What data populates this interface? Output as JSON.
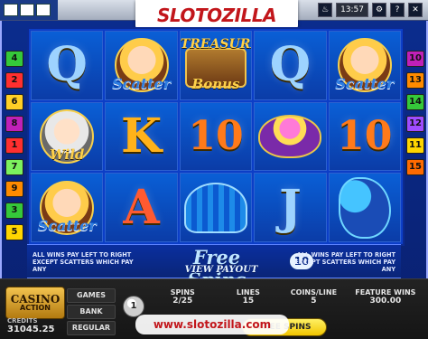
{
  "brand": {
    "logo_text": "SLOTOZILLA"
  },
  "top_bar": {
    "time": "13:57",
    "icons": [
      "fire-icon",
      "settings-icon",
      "help-icon",
      "close-icon"
    ]
  },
  "paylines": {
    "left": [
      {
        "label": "4",
        "color": "#35c83a"
      },
      {
        "label": "2",
        "color": "#ff2f2f"
      },
      {
        "label": "6",
        "color": "#ffcf26"
      },
      {
        "label": "8",
        "color": "#c020b8"
      },
      {
        "label": "1",
        "color": "#ff2f2f"
      },
      {
        "label": "7",
        "color": "#7cf15e"
      },
      {
        "label": "9",
        "color": "#ff8a00"
      },
      {
        "label": "3",
        "color": "#35c83a"
      },
      {
        "label": "5",
        "color": "#ffd500"
      }
    ],
    "right": [
      {
        "label": "10",
        "color": "#c020b8"
      },
      {
        "label": "13",
        "color": "#ff8a00"
      },
      {
        "label": "14",
        "color": "#35c83a"
      },
      {
        "label": "12",
        "color": "#a04cff"
      },
      {
        "label": "11",
        "color": "#ffd500"
      },
      {
        "label": "15",
        "color": "#ff6a00"
      }
    ]
  },
  "reels": [
    {
      "symbol": "Q",
      "kind": "letter",
      "color": "q"
    },
    {
      "symbol": "",
      "kind": "portrait",
      "caption": "Scatter"
    },
    {
      "symbol": "",
      "kind": "treasure",
      "caption_top": "TREASURE",
      "caption": "Bonus"
    },
    {
      "symbol": "Q",
      "kind": "letter",
      "color": "q"
    },
    {
      "symbol": "",
      "kind": "portrait",
      "caption": "Scatter"
    },
    {
      "symbol": "",
      "kind": "wild",
      "caption": "Wild"
    },
    {
      "symbol": "K",
      "kind": "letter",
      "color": "k"
    },
    {
      "symbol": "10",
      "kind": "letter",
      "color": "ten"
    },
    {
      "symbol": "",
      "kind": "pot",
      "caption": ""
    },
    {
      "symbol": "10",
      "kind": "letter",
      "color": "ten"
    },
    {
      "symbol": "",
      "kind": "portrait",
      "caption": "Scatter"
    },
    {
      "symbol": "A",
      "kind": "letter",
      "color": "a"
    },
    {
      "symbol": "",
      "kind": "shell",
      "caption": ""
    },
    {
      "symbol": "J",
      "kind": "letter",
      "color": "q"
    },
    {
      "symbol": "",
      "kind": "seahorse",
      "caption": ""
    }
  ],
  "free_spins": {
    "title": "Free Spins",
    "view_payout": "VIEW PAYOUT",
    "count": "10",
    "left_note": "ALL WINS PAY LEFT TO RIGHT EXCEPT SCATTERS WHICH PAY ANY",
    "right_note": "ALL WINS PAY LEFT TO RIGHT EXCEPT SCATTERS WHICH PAY ANY"
  },
  "console": {
    "casino_top": "CASINO",
    "casino_bottom": "ACTION",
    "credits_label": "CREDITS",
    "credits_value": "31045.25",
    "menu": [
      "GAMES",
      "BANK",
      "REGULAR"
    ],
    "coin_value": "1",
    "stats": [
      {
        "label": "SPINS",
        "value": "2/25"
      },
      {
        "label": "LINES",
        "value": "15"
      },
      {
        "label": "COINS/LINE",
        "value": "5"
      },
      {
        "label": "FEATURE WINS",
        "value": "300.00"
      }
    ],
    "free_spins_button": "FREE SPINS"
  },
  "watermark": "www.slotozilla.com"
}
